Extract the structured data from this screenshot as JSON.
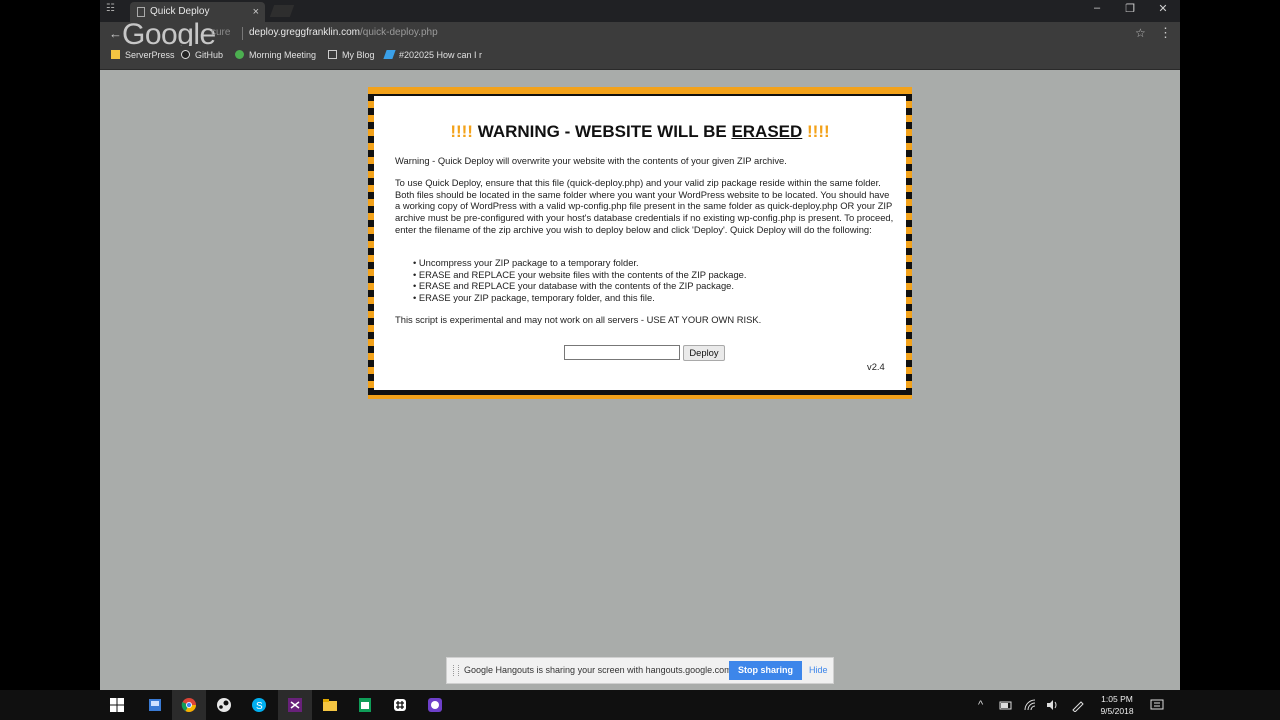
{
  "browser": {
    "tab_title": "Quick Deploy",
    "tab_close": "×",
    "back_glyph": "←",
    "google_logo": "Google",
    "security_label": "cure",
    "url_domain": "deploy.greggfranklin.com",
    "url_path": "/quick-deploy.php",
    "star_glyph": "☆",
    "menu_glyph": "⋮",
    "window_minimize": "–",
    "window_restore": "❐",
    "window_close": "✕",
    "bookmarks": [
      {
        "label": "ServerPress",
        "icon": "folder-icon",
        "color": "#f4c542"
      },
      {
        "label": "GitHub",
        "icon": "github-icon",
        "color": "#dddddd"
      },
      {
        "label": "Morning Meeting",
        "icon": "leaf-icon",
        "color": "#4caf50"
      },
      {
        "label": "My Blog",
        "icon": "page-icon",
        "color": "#cccccc"
      },
      {
        "label": "#202025 How can I r",
        "icon": "stack-icon",
        "color": "#3aa0e8"
      }
    ]
  },
  "warning": {
    "bang_left": "!!!!",
    "title_prefix": " WARNING - WEBSITE WILL BE ",
    "title_erased": "ERASED",
    "bang_right": " !!!!",
    "intro": "Warning - Quick Deploy will overwrite your website with the contents of your given ZIP archive.",
    "instructions": "To use Quick Deploy, ensure that this file (quick-deploy.php) and your valid zip package reside within the same folder. Both files should be located in the same folder where you want your WordPress website to be located. You should have a working copy of WordPress with a valid wp-config.php file present in the same folder as quick-deploy.php OR your ZIP archive must be pre-configured with your host's database credentials if no existing wp-config.php is present. To proceed, enter the filename of the zip archive you wish to deploy below and click 'Deploy'. Quick Deploy will do the following:",
    "steps": [
      "Uncompress your ZIP package to a temporary folder.",
      "ERASE and REPLACE your website files with the contents of the ZIP package.",
      "ERASE and REPLACE your database with the contents of the ZIP package.",
      "ERASE your ZIP package, temporary folder, and this file."
    ],
    "disclaimer": "This script is experimental and may not work on all servers - USE AT YOUR OWN RISK.",
    "input_value": "",
    "deploy_label": "Deploy",
    "version": "v2.4",
    "accent_color": "#f3a21a"
  },
  "hangouts": {
    "message": "Google Hangouts is sharing your screen with hangouts.google.com.",
    "stop_label": "Stop sharing",
    "hide_label": "Hide"
  },
  "taskbar": {
    "time": "1:05 PM",
    "date": "9/5/2018",
    "apps": [
      "windows-start-icon",
      "file-explorer-icon",
      "chrome-icon",
      "steam-icon",
      "skype-icon",
      "visual-studio-icon",
      "folder-icon",
      "sheets-icon",
      "slack-icon",
      "github-desktop-icon"
    ]
  }
}
